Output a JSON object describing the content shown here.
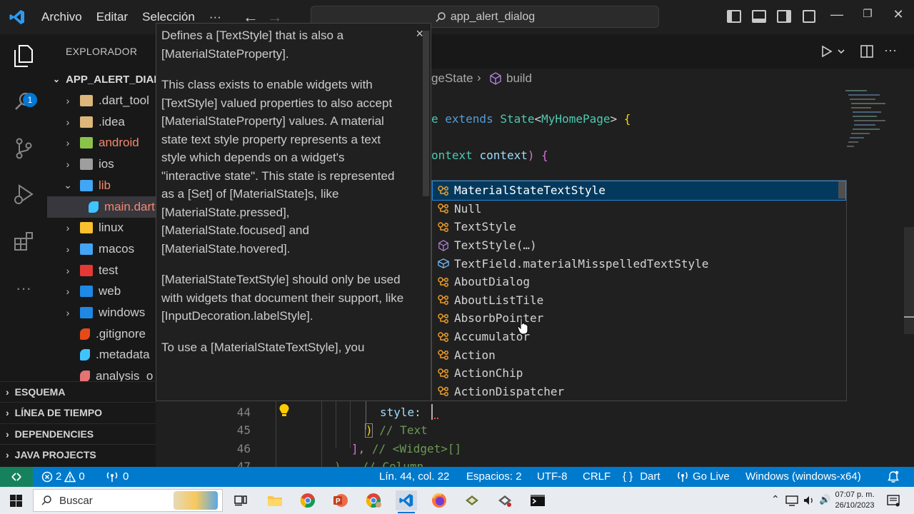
{
  "titlebar": {
    "menu": [
      "Archivo",
      "Editar",
      "Selección",
      "···"
    ],
    "search_text": "app_alert_dialog"
  },
  "activity": {
    "explorer_badge": "1"
  },
  "sidebar": {
    "title": "EXPLORADOR",
    "root": "APP_ALERT_DIALO",
    "items": [
      {
        "label": ".dart_tool",
        "color": "#cccccc",
        "icon_color": "#dcb67a",
        "chevron": "›"
      },
      {
        "label": ".idea",
        "color": "#cccccc",
        "icon_color": "#dcb67a",
        "chevron": "›"
      },
      {
        "label": "android",
        "color": "#f48771",
        "icon_color": "#8bc34a",
        "chevron": "›"
      },
      {
        "label": "ios",
        "color": "#cccccc",
        "icon_color": "#9e9e9e",
        "chevron": "›"
      },
      {
        "label": "lib",
        "color": "#f48771",
        "icon_color": "#42a5f5",
        "chevron": "⌄"
      },
      {
        "label": "main.dart",
        "color": "#f48771",
        "icon_color": "#40c4ff",
        "chevron": ""
      },
      {
        "label": "linux",
        "color": "#cccccc",
        "icon_color": "#fbc02d",
        "chevron": "›"
      },
      {
        "label": "macos",
        "color": "#cccccc",
        "icon_color": "#42a5f5",
        "chevron": "›"
      },
      {
        "label": "test",
        "color": "#cccccc",
        "icon_color": "#e53935",
        "chevron": "›"
      },
      {
        "label": "web",
        "color": "#cccccc",
        "icon_color": "#1e88e5",
        "chevron": "›"
      },
      {
        "label": "windows",
        "color": "#cccccc",
        "icon_color": "#1e88e5",
        "chevron": "›"
      },
      {
        "label": ".gitignore",
        "color": "#cccccc",
        "icon_color": "#e64a19",
        "chevron": ""
      },
      {
        "label": ".metadata",
        "color": "#cccccc",
        "icon_color": "#40c4ff",
        "chevron": ""
      },
      {
        "label": "analysis_o",
        "color": "#cccccc",
        "icon_color": "#e57373",
        "chevron": ""
      }
    ],
    "sections": [
      "ESQUEMA",
      "LÍNEA DE TIEMPO",
      "DEPENDENCIES",
      "JAVA PROJECTS"
    ]
  },
  "breadcrumb": {
    "class_state": "geState",
    "method": "build"
  },
  "code": {
    "line_class": [
      "e ",
      "extends",
      " ",
      "State",
      "<",
      "MyHomePage",
      ">",
      " {"
    ],
    "line_build": [
      "ontext",
      " ",
      "context",
      ") {"
    ],
    "line_numbers": [
      "44",
      "45",
      "46",
      "47"
    ],
    "line44": "style: ",
    "line45_comment": "// Text",
    "line46": "], ",
    "line46_comment": "// <Widget>[]",
    "line47": "),  // Column"
  },
  "suggestions": [
    {
      "label": "MaterialStateTextStyle",
      "kind": "class"
    },
    {
      "label": "Null",
      "kind": "class"
    },
    {
      "label": "TextStyle",
      "kind": "class"
    },
    {
      "label": "TextStyle(…)",
      "kind": "constructor"
    },
    {
      "label": "TextField.materialMisspelledTextStyle",
      "kind": "field"
    },
    {
      "label": "AboutDialog",
      "kind": "class"
    },
    {
      "label": "AboutListTile",
      "kind": "class"
    },
    {
      "label": "AbsorbPointer",
      "kind": "class"
    },
    {
      "label": "Accumulator",
      "kind": "class"
    },
    {
      "label": "Action",
      "kind": "class"
    },
    {
      "label": "ActionChip",
      "kind": "class"
    },
    {
      "label": "ActionDispatcher",
      "kind": "class"
    }
  ],
  "hover_doc": {
    "paragraphs": [
      "Defines a [TextStyle] that is also a [MaterialStateProperty].",
      "This class exists to enable widgets with [TextStyle] valued properties to also accept [MaterialStateProperty] values. A material state text style property represents a text style which depends on a widget's \"interactive state\". This state is represented as a [Set] of [MaterialState]s, like [MaterialState.pressed], [MaterialState.focused] and [MaterialState.hovered].",
      "[MaterialStateTextStyle] should only be used with widgets that document their support, like [InputDecoration.labelStyle].",
      "To use a [MaterialStateTextStyle], you"
    ],
    "close": "×"
  },
  "statusbar": {
    "errors": "2",
    "warnings": "0",
    "ports": "0",
    "position": "Lín. 44, col. 22",
    "spaces": "Espacios: 2",
    "encoding": "UTF-8",
    "eol": "CRLF",
    "language": "Dart",
    "golive": "Go Live",
    "device": "Windows (windows-x64)"
  },
  "taskbar": {
    "search_placeholder": "Buscar",
    "time": "07:07 p. m.",
    "date": "26/10/2023"
  }
}
